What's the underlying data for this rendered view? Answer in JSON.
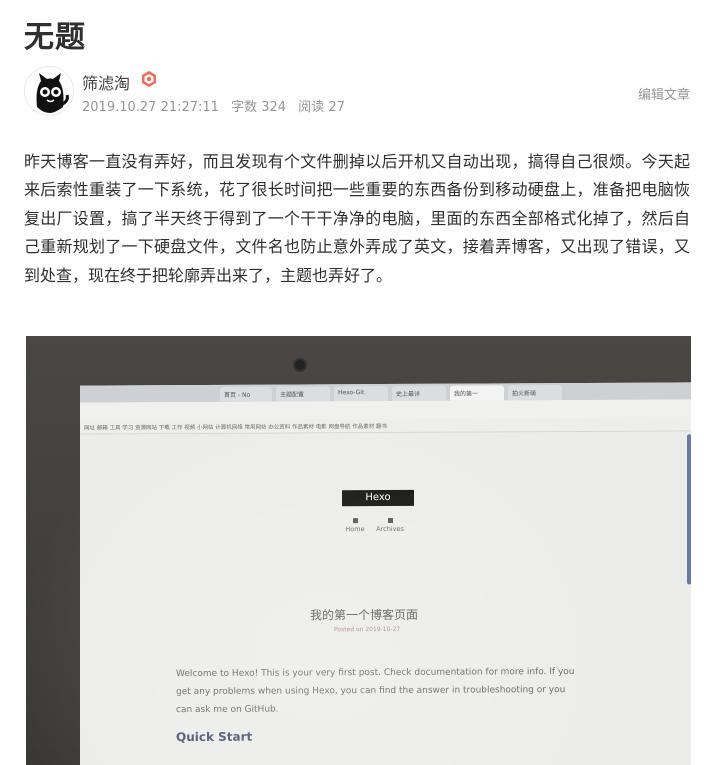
{
  "article": {
    "title": "无题",
    "author": "筛滤淘",
    "date": "2019.10.27 21:27:11",
    "word_count": "字数 324",
    "reads": "阅读 27",
    "edit_label": "编辑文章",
    "body": "昨天博客一直没有弄好，而且发现有个文件删掉以后开机又自动出现，搞得自己很烦。今天起来后索性重装了一下系统，花了很长时间把一些重要的东西备份到移动硬盘上，准备把电脑恢复出厂设置，搞了半天终于得到了一个干干净净的电脑，里面的东西全部格式化掉了，然后自己重新规划了一下硬盘文件，文件名也防止意外弄成了英文，接着弄博客，又出现了错误，又到处查，现在终于把轮廓弄出来了，主题也弄好了。"
  },
  "photo": {
    "tabs": [
      "首页 - No",
      "主题配置",
      "Hexo-Git",
      "史上最详",
      "我的第一",
      "拍火新萌"
    ],
    "bookmarks": "网址  邮箱  工具  学习  资源网站  下载  工作  视频  小网站  计算机网络  常用网站  办公资料  作品素材  电影  网盘导航  作品素材 翻书",
    "blog_logo": "Hexo",
    "nav_home": "Home",
    "nav_archives": "Archives",
    "post_title": "我的第一个博客页面",
    "post_date": "Posted on 2019-10-27",
    "post_body": "Welcome to Hexo! This is your very first post. Check documentation for more info. If you get any problems when using Hexo, you can find the answer in troubleshooting or you can ask me on GitHub.",
    "quick_start": "Quick Start"
  },
  "colors": {
    "badge": "#ea6f5a",
    "meta_gray": "#969696"
  }
}
